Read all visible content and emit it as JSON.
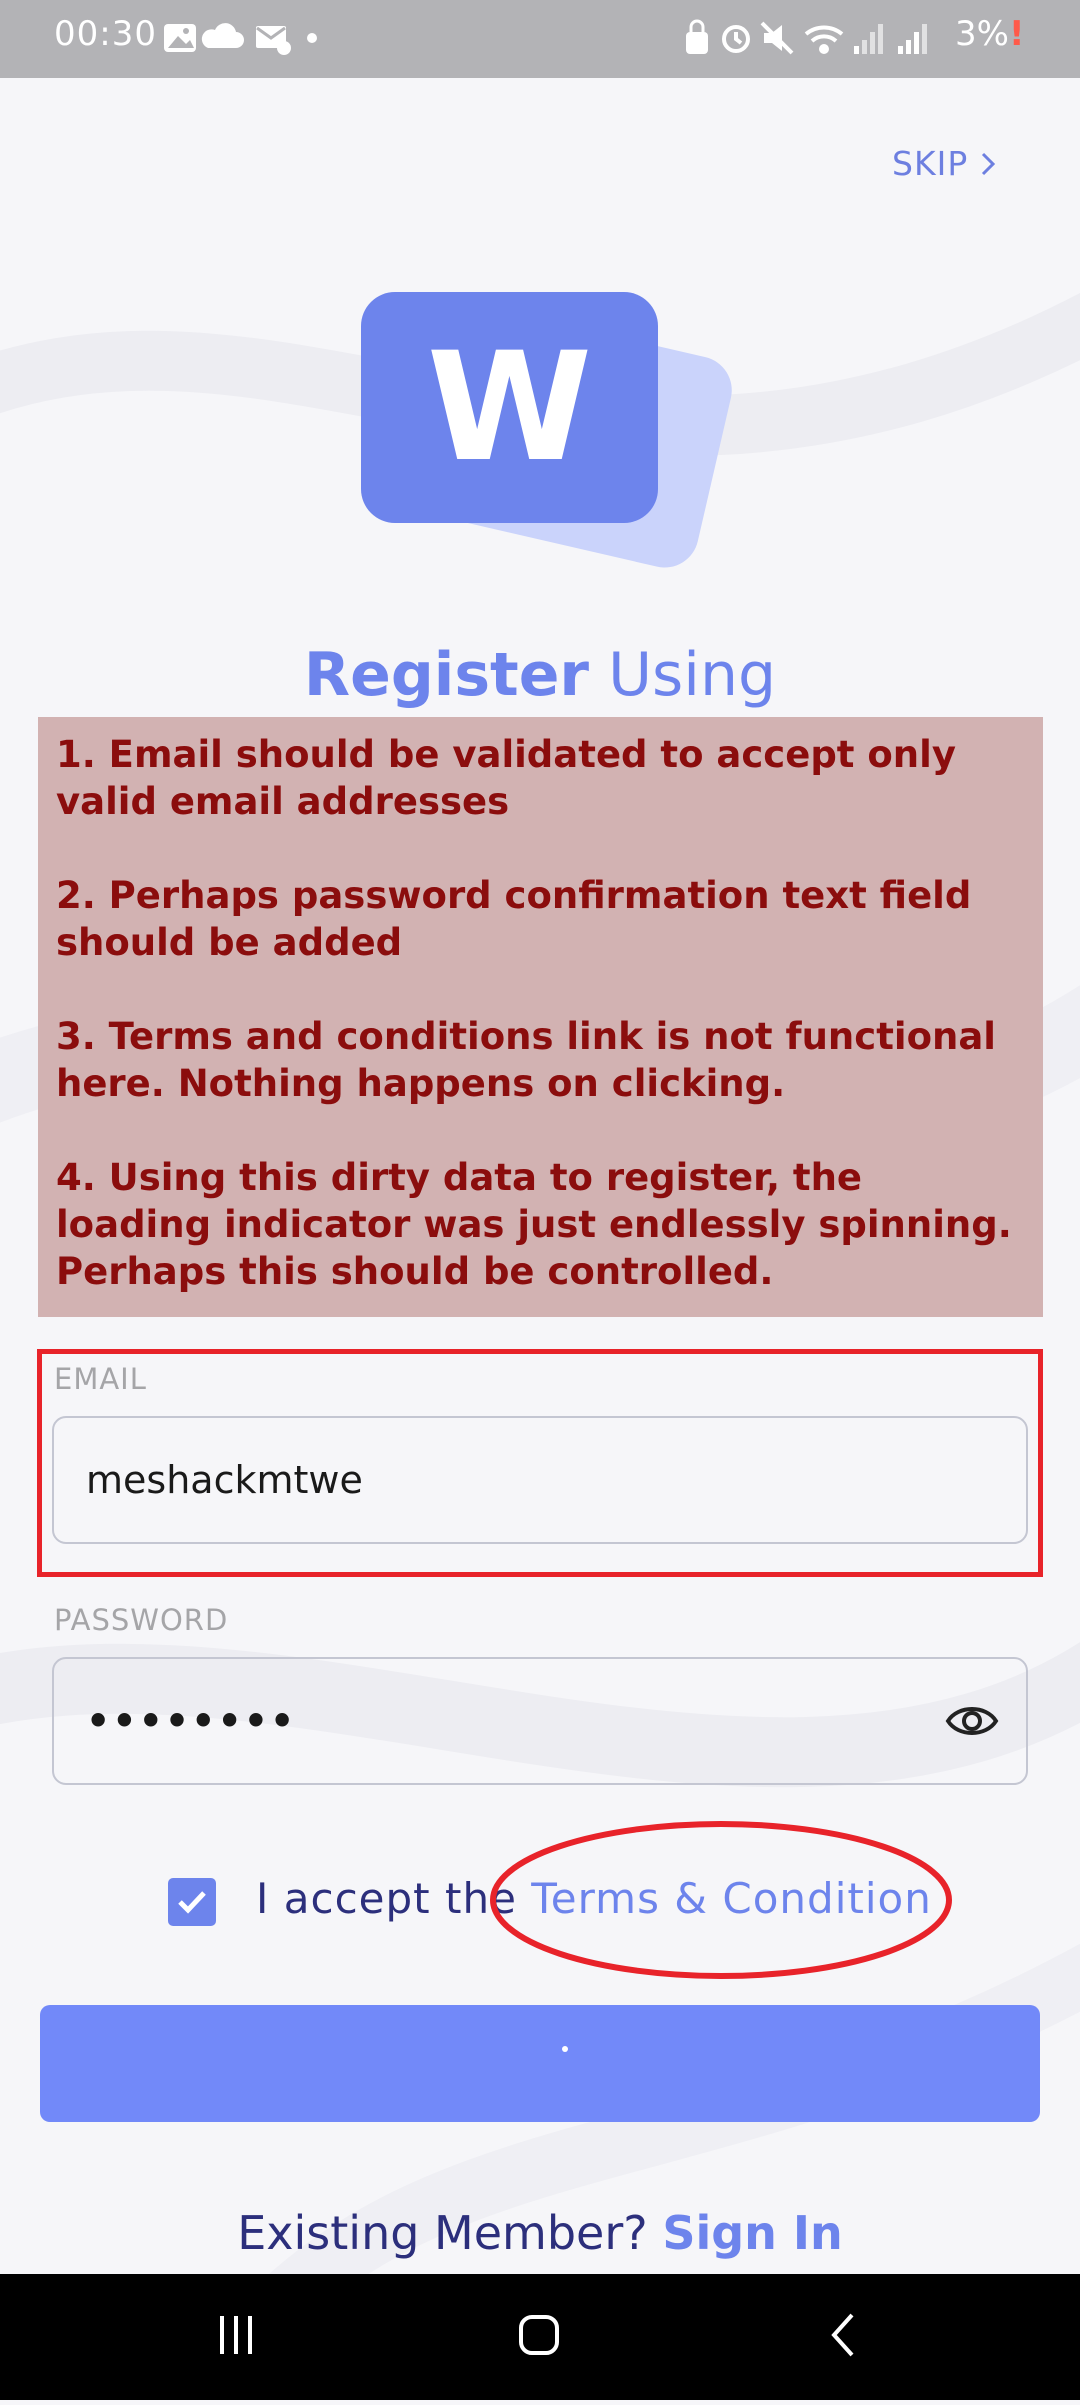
{
  "status_bar": {
    "time": "00:30",
    "battery": "3%",
    "left_icons": [
      "image-icon",
      "cloud-icon",
      "mail-settings-icon",
      "dot-icon"
    ],
    "right_icons": [
      "lock-icon",
      "alarm-icon",
      "mute-icon",
      "wifi-icon",
      "signal-icon",
      "signal-icon"
    ]
  },
  "skip": {
    "label": "SKIP"
  },
  "logo": {
    "letter": "W"
  },
  "heading": {
    "bold": "Register",
    "regular": "Using"
  },
  "annotation": {
    "items": [
      "1. Email should be validated to accept only valid email addresses",
      "2. Perhaps password confirmation text field should be added",
      "3. Terms and conditions link is not functional here. Nothing happens on  clicking.",
      "4. Using this dirty data to register, the loading indicator was just endlessly spinning. Perhaps this should be controlled."
    ]
  },
  "email": {
    "label": "EMAIL",
    "value": "meshackmtwe"
  },
  "password": {
    "label": "PASSWORD",
    "value": "••••••••"
  },
  "terms": {
    "prefix": "I accept the ",
    "link": "Terms & Condition",
    "checked": true
  },
  "footer": {
    "prompt": "Existing Member?",
    "link": "Sign In"
  },
  "colors": {
    "accent": "#6d84ec",
    "button": "#7289f9",
    "annotation_bg": "#d2b2b2",
    "annotation_text": "#8b0d0d",
    "highlight_red": "#e8232a",
    "dark_text": "#2c2f7c"
  }
}
